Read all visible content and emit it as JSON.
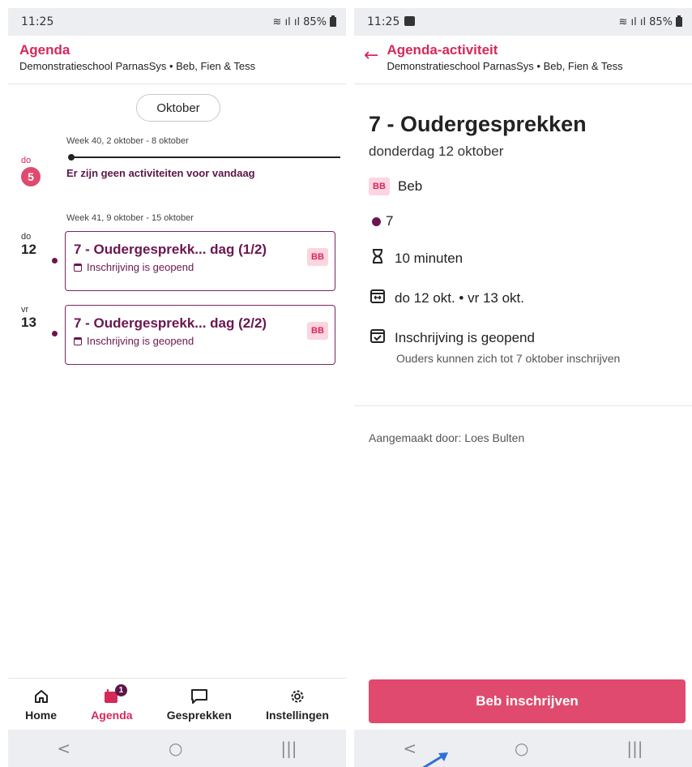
{
  "left": {
    "status": {
      "time": "11:25",
      "battery": "85%"
    },
    "header": {
      "title": "Agenda",
      "subtitle": "Demonstratieschool ParnasSys • Beb, Fien & Tess"
    },
    "month_button": "Oktober",
    "weeks": [
      {
        "label": "Week 40, 2 oktober - 8 oktober"
      },
      {
        "label": "Week 41, 9 oktober - 15 oktober"
      }
    ],
    "today": {
      "day_name": "do",
      "day_num": "5",
      "empty_message": "Er zijn geen activiteiten voor vandaag"
    },
    "events": [
      {
        "day_name": "do",
        "day_num": "12",
        "title": "7 - Oudergesprekk... dag (1/2)",
        "status": "Inschrijving is geopend",
        "badge": "BB"
      },
      {
        "day_name": "vr",
        "day_num": "13",
        "title": "7 - Oudergesprekk... dag (2/2)",
        "status": "Inschrijving is geopend",
        "badge": "BB"
      }
    ],
    "nav": [
      {
        "label": "Home",
        "icon": "home-icon"
      },
      {
        "label": "Agenda",
        "icon": "calendar-icon",
        "badge": "1"
      },
      {
        "label": "Gesprekken",
        "icon": "chat-icon"
      },
      {
        "label": "Instellingen",
        "icon": "gear-icon"
      }
    ]
  },
  "right": {
    "status": {
      "time": "11:25",
      "battery": "85%"
    },
    "header": {
      "title": "Agenda-activiteit",
      "subtitle": "Demonstratieschool ParnasSys • Beb, Fien & Tess"
    },
    "title": "7 - Oudergesprekken",
    "date": "donderdag 12 oktober",
    "child_badge": "BB",
    "child_name": "Beb",
    "group": "7",
    "duration": "10 minuten",
    "range": "do 12 okt. • vr 13 okt.",
    "registration": "Inschrijving is geopend",
    "registration_note": "Ouders kunnen zich tot 7 oktober inschrijven",
    "creator": "Aangemaakt door: Loes Bulten",
    "cta": "Beb inschrijven"
  },
  "system_nav": {
    "back": "<",
    "home": "○",
    "recents": "|||"
  },
  "colors": {
    "accent": "#d7285a",
    "primary_dark": "#6b1650",
    "badge_bg": "#fbd5e0",
    "cta": "#e04a6e"
  }
}
